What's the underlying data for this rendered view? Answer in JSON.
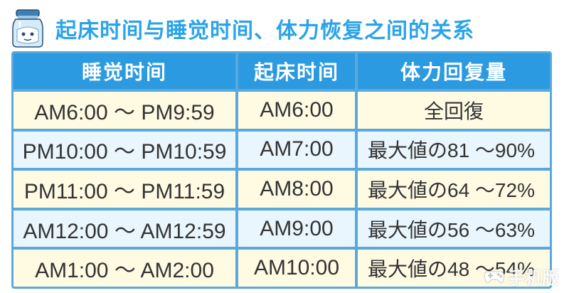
{
  "title": "起床时间与睡觉时间、体力恢复之间的关系",
  "table": {
    "headers": [
      "睡觉时间",
      "起床时间",
      "体力回复量"
    ],
    "rows": [
      {
        "sleep": "AM6:00 ～ PM9:59",
        "wake": "AM6:00",
        "amount": "全回復"
      },
      {
        "sleep": "PM10:00 ～ PM10:59",
        "wake": "AM7:00",
        "amount": "最大値の81 ～90%"
      },
      {
        "sleep": "PM11:00 ～ PM11:59",
        "wake": "AM8:00",
        "amount": "最大値の64 ～72%"
      },
      {
        "sleep": "AM12:00 ～ AM12:59",
        "wake": "AM9:00",
        "amount": "最大値の56 ～63%"
      },
      {
        "sleep": "AM1:00 ～ AM2:00",
        "wake": "AM10:00",
        "amount": "最大値の48 ～54%"
      }
    ]
  },
  "watermark": "手机版",
  "colors": {
    "title": "#2aa4e8",
    "header_bg": "#2b9ae0",
    "border": "#5aa9dc",
    "row_odd": "#fffbe3",
    "row_even": "#e9f6fd"
  },
  "icons": {
    "header_icon": "milk-jar-icon",
    "watermark_icon": "gamepad-icon"
  }
}
